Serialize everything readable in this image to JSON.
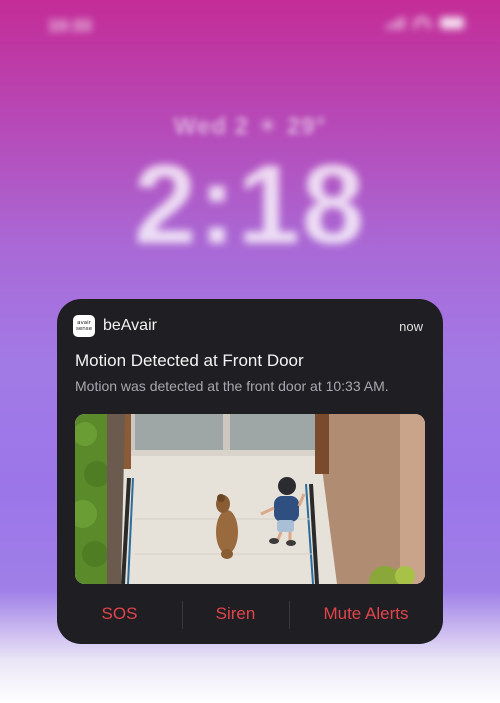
{
  "status_bar": {
    "time": "10:33",
    "icons": [
      "signal-icon",
      "wifi-icon",
      "battery-icon"
    ]
  },
  "lock_screen": {
    "date": "Wed 2  ☀ 29°",
    "time": "2:18"
  },
  "notification": {
    "app_icon_text": [
      "avair",
      "sense"
    ],
    "app_name": "beAvair",
    "time": "now",
    "title": "Motion Detected at Front Door",
    "body": "Motion was detected at the front door at 10:33 AM.",
    "image": "camera-snapshot",
    "actions": [
      {
        "label": "SOS"
      },
      {
        "label": "Siren"
      },
      {
        "label": "Mute Alerts"
      }
    ],
    "action_color": "#e0454c",
    "background": "#1f1e22"
  }
}
